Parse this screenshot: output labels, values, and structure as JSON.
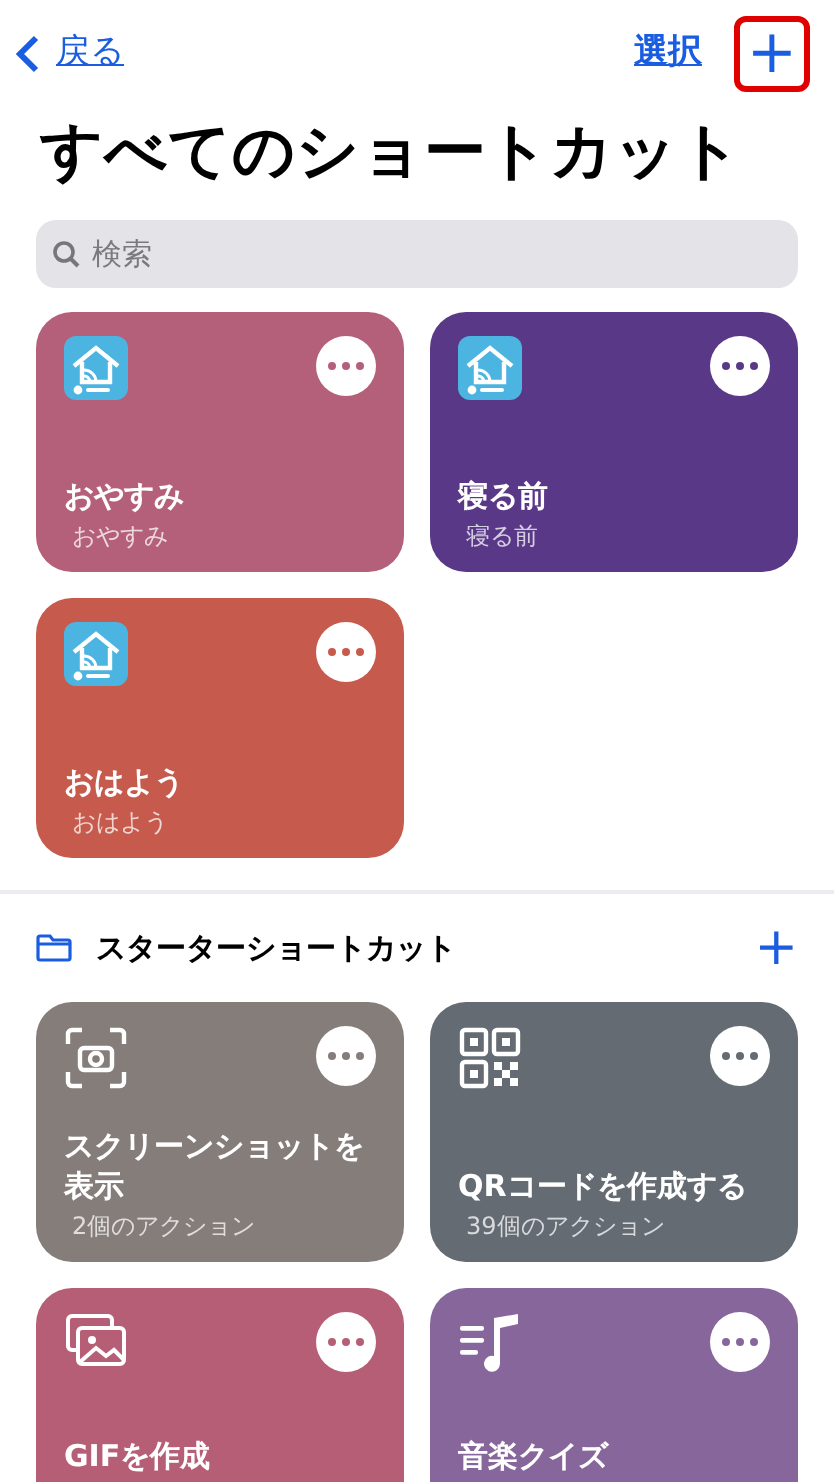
{
  "nav": {
    "back": "戻る",
    "select": "選択",
    "add": "+",
    "add_highlighted": true
  },
  "title": "すべてのショートカット",
  "search": {
    "placeholder": "検索"
  },
  "shortcuts": [
    {
      "kind": "app",
      "title": "おやすみ",
      "subtitle": "おやすみ",
      "color": "#b4607a"
    },
    {
      "kind": "app",
      "title": "寝る前",
      "subtitle": "寝る前",
      "color": "#5a3888"
    },
    {
      "kind": "app",
      "title": "おはよう",
      "subtitle": "おはよう",
      "color": "#c65a4c"
    }
  ],
  "folder": {
    "title": "スターターショートカット",
    "add": "+"
  },
  "starters": [
    {
      "kind": "screenshot",
      "title": "スクリーンショットを表示",
      "subtitle": "2個のアクション",
      "color": "#857d7a"
    },
    {
      "kind": "qr",
      "title": "QRコードを作成する",
      "subtitle": "39個のアクション",
      "color": "#646b73"
    },
    {
      "kind": "gif",
      "title": "GIFを作成",
      "color": "#b55e76"
    },
    {
      "kind": "music",
      "title": "音楽クイズ",
      "color": "#87669c"
    }
  ]
}
